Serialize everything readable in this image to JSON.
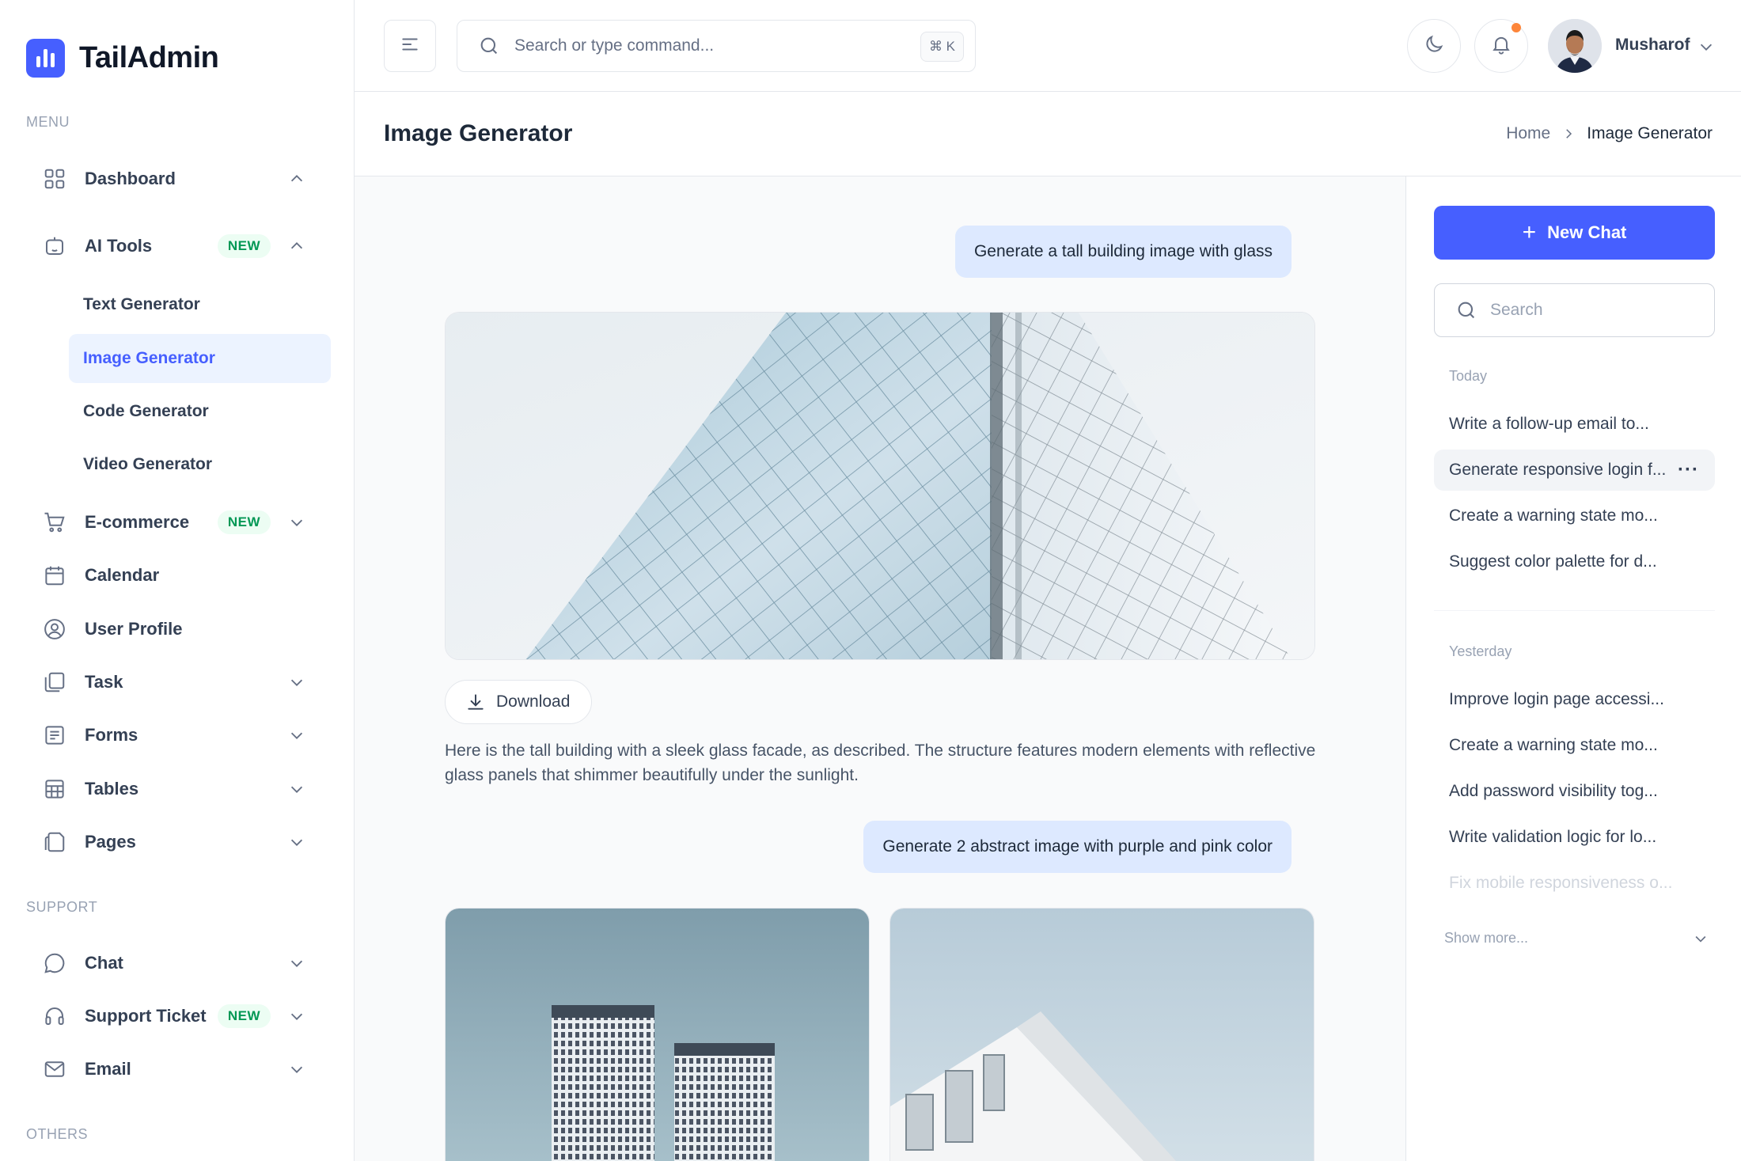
{
  "app": {
    "name": "TailAdmin"
  },
  "sidebar": {
    "menu_label": "MENU",
    "support_label": "SUPPORT",
    "others_label": "OTHERS",
    "items": [
      {
        "label": "Dashboard",
        "icon": "grid-icon",
        "chevron": "up"
      },
      {
        "label": "AI Tools",
        "icon": "robot-icon",
        "badge": "NEW",
        "chevron": "up"
      },
      {
        "label": "E-commerce",
        "icon": "cart-icon",
        "badge": "NEW",
        "chevron": "down"
      },
      {
        "label": "Calendar",
        "icon": "calendar-icon"
      },
      {
        "label": "User Profile",
        "icon": "user-circle-icon"
      },
      {
        "label": "Task",
        "icon": "task-icon",
        "chevron": "down"
      },
      {
        "label": "Forms",
        "icon": "forms-icon",
        "chevron": "down"
      },
      {
        "label": "Tables",
        "icon": "table-icon",
        "chevron": "down"
      },
      {
        "label": "Pages",
        "icon": "pages-icon",
        "chevron": "down"
      }
    ],
    "ai_sub_items": [
      {
        "label": "Text Generator",
        "active": false
      },
      {
        "label": "Image Generator",
        "active": true
      },
      {
        "label": "Code Generator",
        "active": false
      },
      {
        "label": "Video Generator",
        "active": false
      }
    ],
    "support_items": [
      {
        "label": "Chat",
        "icon": "chat-icon",
        "chevron": "down"
      },
      {
        "label": "Support Ticket",
        "icon": "headset-icon",
        "badge": "NEW",
        "chevron": "down"
      },
      {
        "label": "Email",
        "icon": "mail-icon",
        "chevron": "down"
      }
    ]
  },
  "header": {
    "search_placeholder": "Search or type command...",
    "shortcut": "⌘ K",
    "user_name": "Musharof"
  },
  "page": {
    "title": "Image Generator",
    "breadcrumb": {
      "home": "Home",
      "current": "Image Generator"
    }
  },
  "chat": {
    "messages": [
      {
        "role": "user",
        "text": "Generate a tall building image with glass"
      },
      {
        "role": "assistant",
        "download_label": "Download",
        "text": "Here is the tall building with a sleek glass facade, as described. The structure features modern elements with reflective glass panels that shimmer beautifully under the sunlight."
      },
      {
        "role": "user",
        "text": "Generate 2 abstract image with purple and pink color"
      }
    ]
  },
  "history": {
    "new_chat_label": "New Chat",
    "search_placeholder": "Search",
    "today_label": "Today",
    "today": [
      "Write a follow-up email to...",
      "Generate responsive login f...",
      "Create a warning state mo...",
      "Suggest color palette for d..."
    ],
    "yesterday_label": "Yesterday",
    "yesterday": [
      "Improve login page accessi...",
      "Create a warning state mo...",
      "Add password visibility tog...",
      "Write validation logic for lo...",
      "Fix mobile responsiveness o..."
    ],
    "show_more": "Show more..."
  },
  "colors": {
    "brand": "#465fff",
    "badge_bg": "#ecfdf3",
    "badge_text": "#039855",
    "notification_dot": "#fd853a"
  }
}
